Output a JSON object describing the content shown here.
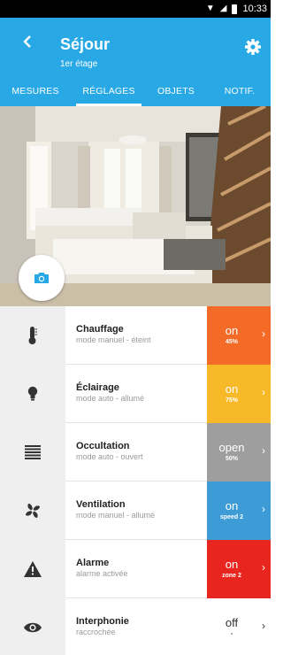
{
  "status": {
    "time": "10:33"
  },
  "header": {
    "title": "Séjour",
    "subtitle": "1er étage"
  },
  "tabs": [
    {
      "label": "MESURES",
      "active": false
    },
    {
      "label": "RÉGLAGES",
      "active": true
    },
    {
      "label": "OBJETS",
      "active": false
    },
    {
      "label": "NOTIF.",
      "active": false
    }
  ],
  "items": [
    {
      "name": "Chauffage",
      "mode": "mode manuel - éteint",
      "state": "on",
      "detail": "45%",
      "icon": "thermometer-icon",
      "color": "#f46a27"
    },
    {
      "name": "Éclairage",
      "mode": "mode auto - allumé",
      "state": "on",
      "detail": "75%",
      "icon": "lightbulb-icon",
      "color": "#f7b928"
    },
    {
      "name": "Occultation",
      "mode": "mode auto - ouvert",
      "state": "open",
      "detail": "50%",
      "icon": "shutter-icon",
      "color": "#9e9e9e"
    },
    {
      "name": "Ventilation",
      "mode": "mode manuel - allumé",
      "state": "on",
      "detail": "speed 2",
      "icon": "fan-icon",
      "color": "#3d9bd6"
    },
    {
      "name": "Alarme",
      "mode": "alarme activée",
      "state": "on",
      "detail": "zone 2",
      "icon": "warning-icon",
      "color": "#e8251e"
    },
    {
      "name": "Interphonie",
      "mode": "raccrochée",
      "state": "off",
      "detail": "-",
      "icon": "eye-icon",
      "color": "#ffffff"
    }
  ]
}
